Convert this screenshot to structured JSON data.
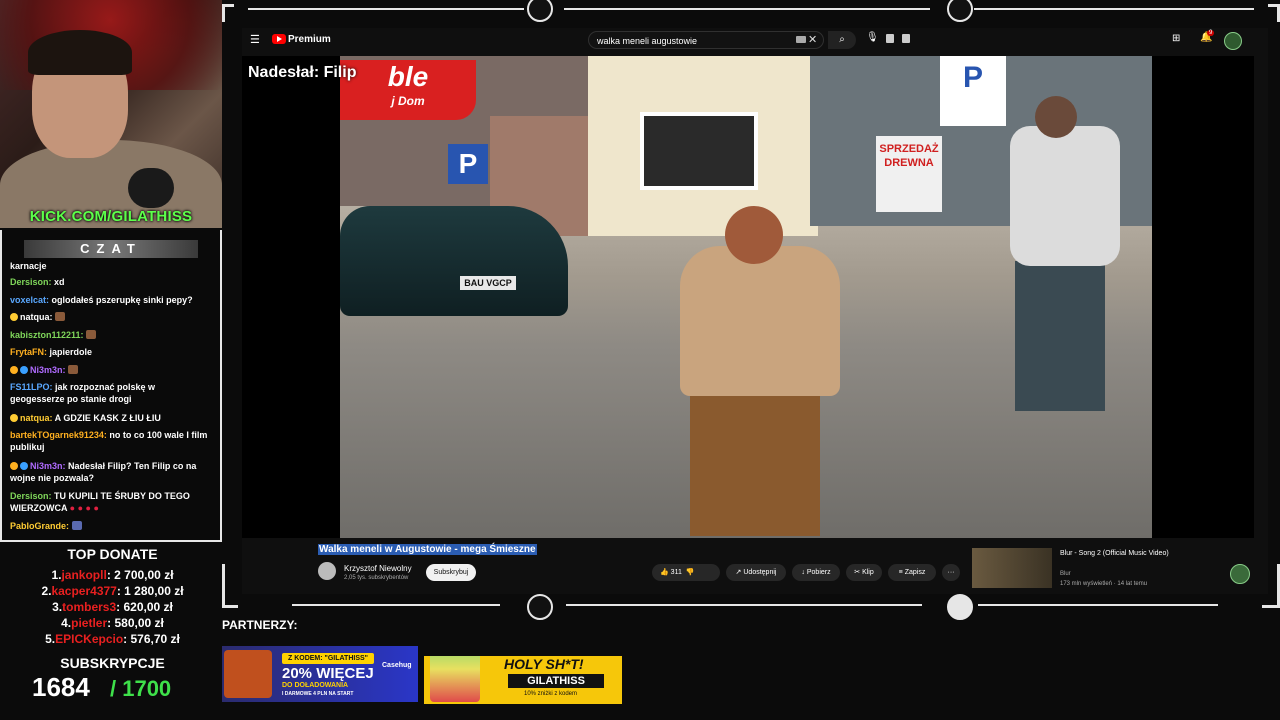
{
  "stream": {
    "kick_url": "KICK.COM/GILATHISS",
    "chat_title": "CZAT"
  },
  "chat": {
    "messages": [
      {
        "user": "",
        "text": "karnacje",
        "color": "#ffffff"
      },
      {
        "user": "Dersison:",
        "text": "xd",
        "color": "#7fd65a"
      },
      {
        "user": "voxelcat:",
        "text": "oglodałeś pszerupkę sinki pepy?",
        "color": "#5aa8ff"
      },
      {
        "user": "natqua:",
        "text": "",
        "color": "#ffcc33"
      },
      {
        "user": "kabiszton112211:",
        "text": "",
        "color": "#7fd65a"
      },
      {
        "user": "FrytaFN:",
        "text": "japierdole",
        "color": "#ffb020"
      },
      {
        "user": "Ni3m3n:",
        "text": "",
        "color": "#b06bff"
      },
      {
        "user": "FS11LPO:",
        "text": "jak rozpoznać polskę w geogesserze po stanie drogi",
        "color": "#5aa8ff"
      },
      {
        "user": "natqua:",
        "text": "A GDZIE KASK Z ŁIU ŁIU",
        "color": "#ffcc33"
      },
      {
        "user": "bartekTOgarnek91234:",
        "text": "no to co 100 wale I film publikuj",
        "color": "#ffb020"
      },
      {
        "user": "Ni3m3n:",
        "text": "Nadesłał Filip? Ten Filip co na wojne nie pozwala?",
        "color": "#b06bff"
      },
      {
        "user": "Dersison:",
        "text": "TU KUPILI TE ŚRUBY DO TEGO WIERZOWCA",
        "color": "#7fd65a"
      },
      {
        "user": "PabloGrande:",
        "text": "",
        "color": "#ffcc33"
      }
    ]
  },
  "donate": {
    "title": "TOP DONATE",
    "rows": [
      {
        "rank": "1.",
        "name": "jankopll",
        "amount": ": 2 700,00 zł"
      },
      {
        "rank": "2.",
        "name": "kacper4377",
        "amount": ": 1 280,00 zł"
      },
      {
        "rank": "3.",
        "name": "tombers3",
        "amount": ": 620,00 zł"
      },
      {
        "rank": "4.",
        "name": "pietler",
        "amount": ": 580,00 zł"
      },
      {
        "rank": "5.",
        "name": "EPICKepcio",
        "amount": ": 576,70 zł"
      }
    ]
  },
  "subs": {
    "title": "SUBSKRYPCJE",
    "count": "1684",
    "goal": "/ 1700"
  },
  "youtube": {
    "brand": "Premium",
    "search_value": "walka meneli augustowie",
    "notif_count": "9",
    "subtitle_label": "Nadesłał: Filip",
    "plate": "BAU VGCP",
    "signs": {
      "parking": "P",
      "sprzedaz": "SPRZEDAŻ DREWNA",
      "bar": "ble",
      "bar_sub": "j Dom"
    },
    "video_title": "Walka meneli w Augustowie - mega Śmieszne",
    "channel": "Krzysztof Niewolny",
    "channel_subs": "2,05 tys. subskrybentów",
    "subscribe": "Subskrybuj",
    "likes": "311",
    "share": "Udostępnij",
    "download": "Pobierz",
    "clip": "Klip",
    "save": "Zapisz",
    "more": "···",
    "rec_title": "Blur - Song 2 (Official Music Video)",
    "rec_channel": "Blur",
    "rec_meta": "173 mln wyświetleń · 14 lat temu"
  },
  "partners": {
    "label": "PARTNERZY:",
    "banner1": {
      "code": "Z KODEM: \"GILATHISS\"",
      "brand": "Casehug",
      "big": "20% WIĘCEJ",
      "sub1": "DO DOŁADOWANIA",
      "sub2": "I DARMOWE 4 PLN NA START"
    },
    "banner2": {
      "title": "HOLY SH*T!",
      "code": "GILATHISS",
      "sub": "10% zniżki z kodem"
    }
  },
  "colors": {
    "kick_green": "#5cff4a",
    "donor_red": "#e82020",
    "goal_green": "#3ee04a",
    "youtube_red": "#ff0000"
  }
}
